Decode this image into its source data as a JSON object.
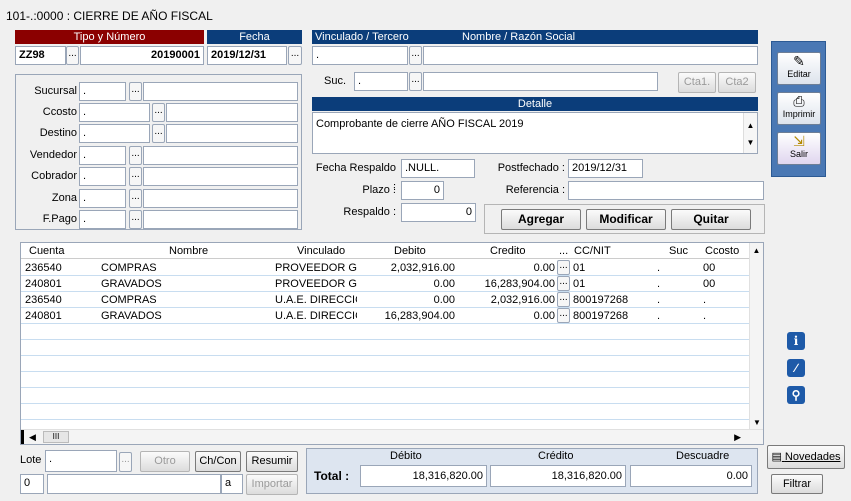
{
  "window_title": "101-.:0000 : CIERRE DE AÑO FISCAL",
  "tipo_numero": {
    "header": "Tipo y Número",
    "tipo": "ZZ98",
    "numero": "20190001"
  },
  "fecha": {
    "header": "Fecha",
    "value": "2019/12/31"
  },
  "vinculado": {
    "header": "Vinculado / Tercero",
    "nombre_header": "Nombre / Razón Social",
    "value": ".",
    "nombre": ""
  },
  "suc": {
    "label": "Suc.",
    "value": ".",
    "cta1": "Cta1.",
    "cta2": "Cta2"
  },
  "detalle": {
    "header": "Detalle",
    "text": "Comprobante de cierre AÑO FISCAL      2019"
  },
  "left_fields": [
    {
      "label": "Sucursal",
      "value": "."
    },
    {
      "label": "Ccosto",
      "value": "."
    },
    {
      "label": "Destino",
      "value": "."
    },
    {
      "label": "Vendedor",
      "value": "."
    },
    {
      "label": "Cobrador",
      "value": "."
    },
    {
      "label": "Zona",
      "value": "."
    },
    {
      "label": "F.Pago",
      "value": "."
    }
  ],
  "fecha_respaldo": {
    "label": "Fecha Respaldo :",
    "value": ".NULL."
  },
  "postfechado": {
    "label": "Postfechado :",
    "value": "2019/12/31"
  },
  "plazo": {
    "label": "Plazo :",
    "value": "0"
  },
  "referencia": {
    "label": "Referencia :",
    "value": ""
  },
  "respaldo": {
    "label": "Respaldo :",
    "value": "0"
  },
  "actions": {
    "agregar": "Agregar",
    "modificar": "Modificar",
    "quitar": "Quitar"
  },
  "right_panel": {
    "editar": "Editar",
    "imprimir": "Imprimir",
    "salir": "Salir"
  },
  "grid": {
    "columns": [
      "Cuenta",
      "Nombre",
      "Vinculado",
      "Debito",
      "Credito",
      "...",
      "CC/NIT",
      "Suc",
      "Ccosto"
    ],
    "rows": [
      {
        "cuenta": "236540",
        "nombre": "COMPRAS",
        "vinculado": "PROVEEDOR GEN",
        "debito": "2,032,916.00",
        "credito": "0.00",
        "ccnit": "01",
        "suc": ".",
        "ccosto": "00"
      },
      {
        "cuenta": "240801",
        "nombre": "GRAVADOS",
        "vinculado": "PROVEEDOR GEN",
        "debito": "0.00",
        "credito": "16,283,904.00",
        "ccnit": "01",
        "suc": ".",
        "ccosto": "00"
      },
      {
        "cuenta": "236540",
        "nombre": "COMPRAS",
        "vinculado": "U.A.E. DIRECCIO",
        "debito": "0.00",
        "credito": "2,032,916.00",
        "ccnit": "800197268",
        "suc": ".",
        "ccosto": "."
      },
      {
        "cuenta": "240801",
        "nombre": "GRAVADOS",
        "vinculado": "U.A.E. DIRECCIO",
        "debito": "16,283,904.00",
        "credito": "0.00",
        "ccnit": "800197268",
        "suc": ".",
        "ccosto": "."
      }
    ],
    "scroll_label": "III"
  },
  "bottom": {
    "lote_label": "Lote",
    "lote_value": ".",
    "otro": "Otro",
    "chcon": "Ch/Con",
    "resumir": "Resumir",
    "zero": "0",
    "a": "a",
    "importar": "Importar"
  },
  "totals": {
    "label": "Total :",
    "debito_h": "Débito",
    "credito_h": "Crédito",
    "descuadre_h": "Descuadre",
    "debito": "18,316,820.00",
    "credito": "18,316,820.00",
    "descuadre": "0.00"
  },
  "side": {
    "novedades": "Novedades",
    "filtrar": "Filtrar"
  }
}
